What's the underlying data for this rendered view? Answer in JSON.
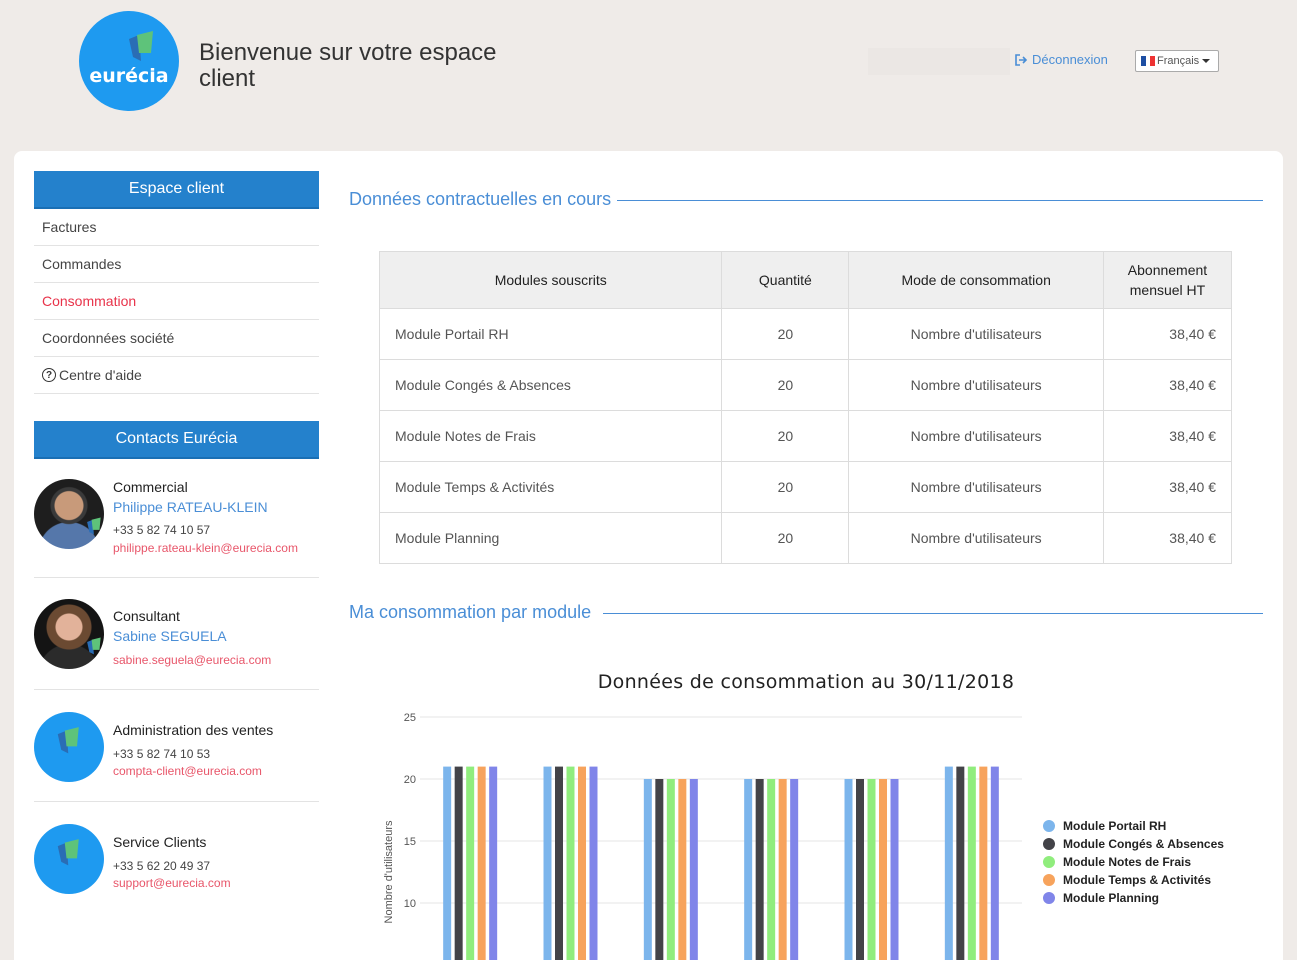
{
  "header": {
    "logo_text": "eurécia",
    "welcome": "Bienvenue sur votre espace client",
    "logout": "Déconnexion",
    "language": "Français"
  },
  "sidebar": {
    "title": "Espace client",
    "items": [
      {
        "label": "Factures"
      },
      {
        "label": "Commandes"
      },
      {
        "label": "Consommation",
        "active": true
      },
      {
        "label": "Coordonnées société"
      },
      {
        "label": "Centre d'aide",
        "icon": "help-circle-icon"
      }
    ],
    "contacts_title": "Contacts Eurécia",
    "contacts": [
      {
        "role": "Commercial",
        "name": "Philippe RATEAU-KLEIN",
        "phone": "+33 5 82 74 10 57",
        "email": "philippe.rateau-klein@eurecia.com"
      },
      {
        "role": "Consultant",
        "name": "Sabine SEGUELA",
        "phone": "",
        "email": "sabine.seguela@eurecia.com"
      },
      {
        "role": "Administration des ventes",
        "name": "",
        "phone": "+33 5 82 74 10 53",
        "email": "compta-client@eurecia.com"
      },
      {
        "role": "Service Clients",
        "name": "",
        "phone": "+33 5 62 20 49 37",
        "email": "support@eurecia.com"
      }
    ]
  },
  "contract": {
    "title": "Données contractuelles en cours",
    "headers": [
      "Modules souscrits",
      "Quantité",
      "Mode de consommation",
      "Abonnement mensuel HT"
    ],
    "rows": [
      [
        "Module Portail RH",
        "20",
        "Nombre d'utilisateurs",
        "38,40 €"
      ],
      [
        "Module Congés & Absences",
        "20",
        "Nombre d'utilisateurs",
        "38,40 €"
      ],
      [
        "Module Notes de Frais",
        "20",
        "Nombre d'utilisateurs",
        "38,40 €"
      ],
      [
        "Module Temps & Activités",
        "20",
        "Nombre d'utilisateurs",
        "38,40 €"
      ],
      [
        "Module Planning",
        "20",
        "Nombre d'utilisateurs",
        "38,40 €"
      ]
    ]
  },
  "consumption": {
    "title": "Ma consommation par module"
  },
  "colors": {
    "accent": "#2481cc",
    "link": "#4a8ed6",
    "active": "#e8334a",
    "email": "#e8566a",
    "logo": "#1e9af0"
  },
  "chart_data": {
    "type": "bar",
    "title": "Données de consommation au 30/11/2018",
    "ylabel": "Nombre d'utilisateurs",
    "xlabel": "",
    "yticks": [
      10,
      15,
      20,
      25
    ],
    "ylim": [
      0,
      25
    ],
    "grid": true,
    "legend_position": "right",
    "categories": [
      "",
      "",
      "",
      "",
      "",
      ""
    ],
    "series": [
      {
        "name": "Module Portail RH",
        "color": "#7cb5ec",
        "values": [
          21,
          21,
          20,
          20,
          20,
          21
        ]
      },
      {
        "name": "Module Congés & Absences",
        "color": "#434348",
        "values": [
          21,
          21,
          20,
          20,
          20,
          21
        ]
      },
      {
        "name": "Module Notes de Frais",
        "color": "#90ed7d",
        "values": [
          21,
          21,
          20,
          20,
          20,
          21
        ]
      },
      {
        "name": "Module Temps & Activités",
        "color": "#f7a35c",
        "values": [
          21,
          21,
          20,
          20,
          20,
          21
        ]
      },
      {
        "name": "Module Planning",
        "color": "#8085e9",
        "values": [
          21,
          21,
          20,
          20,
          20,
          21
        ]
      }
    ]
  }
}
